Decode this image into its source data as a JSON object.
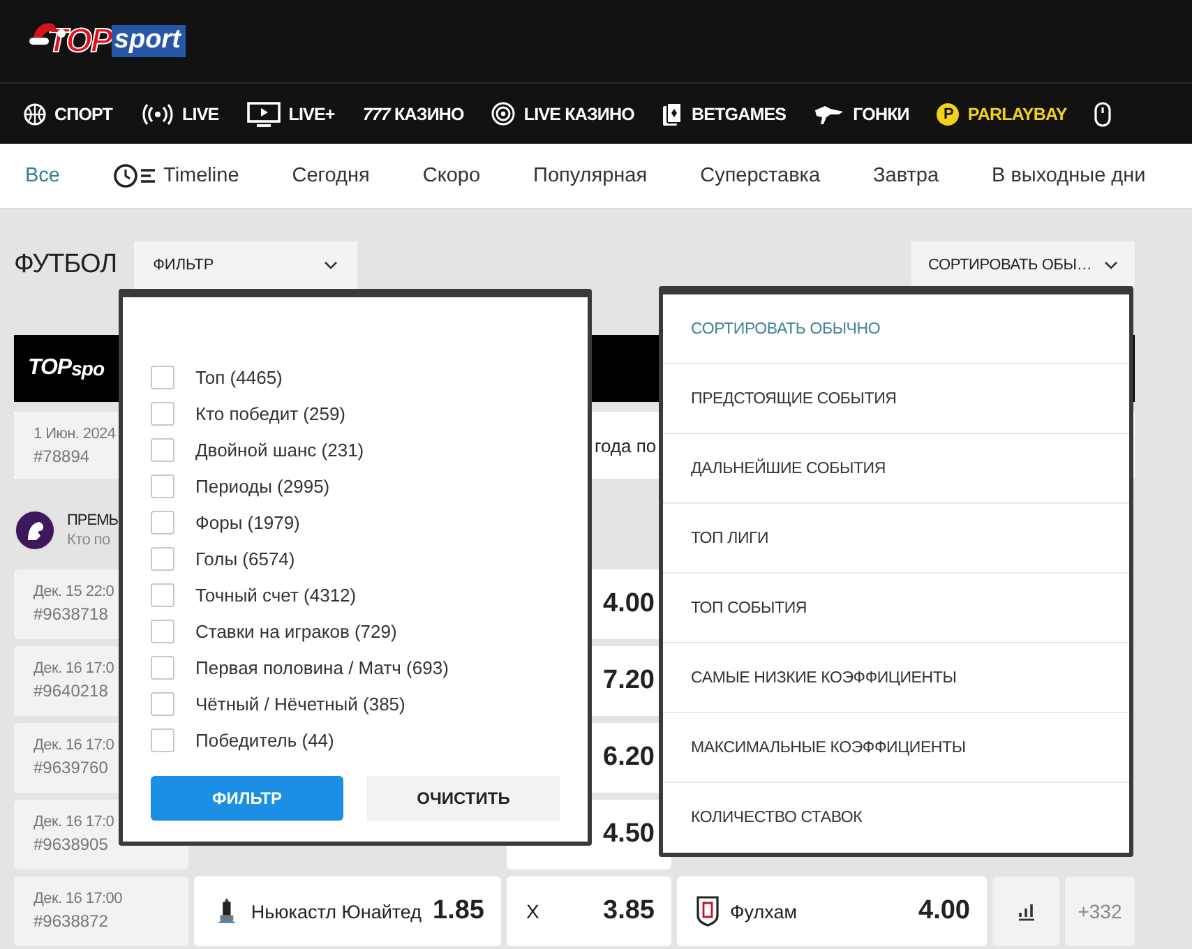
{
  "header": {
    "logo": {
      "part_1": "TOP",
      "part_2": "sport"
    }
  },
  "nav": [
    {
      "kind": "ball",
      "label": "СПОРТ",
      "highlighted": false
    },
    {
      "kind": "live",
      "label": "LIVE",
      "highlighted": false
    },
    {
      "kind": "tv",
      "label": "LIVE+",
      "highlighted": false
    },
    {
      "kind": "plain",
      "label": "*777* КАЗИНО",
      "highlighted": false
    },
    {
      "kind": "target",
      "label": "LIVE КАЗИНО",
      "highlighted": false
    },
    {
      "kind": "cards",
      "label": "BETGAMES",
      "highlighted": false
    },
    {
      "kind": "dog",
      "label": "ГОНКИ",
      "highlighted": false
    },
    {
      "kind": "coin",
      "icon_text": "P",
      "label": "PARLAYBAY",
      "highlighted": true
    },
    {
      "kind": "mouse"
    }
  ],
  "tabs": [
    {
      "label": "Все",
      "selected": true
    },
    {
      "label": "Timeline",
      "kind": "timeline",
      "selected": false
    },
    {
      "label": "Сегодня",
      "selected": false
    },
    {
      "label": "Скоро",
      "selected": false
    },
    {
      "label": "Популярная",
      "selected": false
    },
    {
      "label": "Суперставка",
      "selected": false
    },
    {
      "label": "Завтра",
      "selected": false
    },
    {
      "label": "В выходные дни",
      "selected": false
    }
  ],
  "toolbar": {
    "title": "ФУТБОЛ",
    "filter_button": "ФИЛЬТР",
    "sort_button": "СОРТИРОВАТЬ ОБЫ…"
  },
  "banner": {
    "part_1": "TOP",
    "part_2": "spo"
  },
  "promo": {
    "date": "1 Июн. 2024",
    "id": "#78894",
    "text": "года по"
  },
  "league": {
    "title": "ПРЕМЬ",
    "subtitle": "Кто по"
  },
  "matches": [
    {
      "date": "Дек. 15 22:0",
      "id": "#9638718",
      "draw_odds": "4.00"
    },
    {
      "date": "Дек. 16 17:0",
      "id": "#9640218",
      "draw_odds": "7.20"
    },
    {
      "date": "Дек. 16 17:0",
      "id": "#9639760",
      "draw_odds": "6.20"
    },
    {
      "date": "Дек. 16 17:0",
      "id": "#9638905",
      "draw_odds": "4.50"
    },
    {
      "date": "Дек. 16 17:00",
      "id": "#9638872",
      "home": "Ньюкастл Юнайтед",
      "home_odds": "1.85",
      "draw_label": "X",
      "draw_odds": "3.85",
      "away": "Фулхам",
      "away_odds": "4.00",
      "more": "+332"
    }
  ],
  "filter_menu": {
    "options": [
      {
        "label": "Топ (4465)",
        "checked": false
      },
      {
        "label": "Кто победит (259)",
        "checked": false
      },
      {
        "label": "Двойной шанс (231)",
        "checked": false
      },
      {
        "label": "Периоды (2995)",
        "checked": false
      },
      {
        "label": "Форы (1979)",
        "checked": false
      },
      {
        "label": "Голы (6574)",
        "checked": false
      },
      {
        "label": "Точный счет (4312)",
        "checked": false
      },
      {
        "label": "Ставки на играков (729)",
        "checked": false
      },
      {
        "label": "Первая половина / Матч (693)",
        "checked": false
      },
      {
        "label": "Чётный / Нёчетный (385)",
        "checked": false
      },
      {
        "label": "Победитель (44)",
        "checked": false
      }
    ],
    "buttons": [
      {
        "label": "ФИЛЬТР",
        "kind": "primary"
      },
      {
        "label": "ОЧИСТИТЬ",
        "kind": "secondary"
      }
    ]
  },
  "sort_menu": {
    "options": [
      {
        "label": "СОРТИРОВАТЬ ОБЫЧНО",
        "selected": true
      },
      {
        "label": "ПРЕДСТОЯЩИЕ СОБЫТИЯ",
        "selected": false
      },
      {
        "label": "ДАЛЬНЕЙШИЕ СОБЫТИЯ",
        "selected": false
      },
      {
        "label": "ТОП ЛИГИ",
        "selected": false
      },
      {
        "label": "ТОП СОБЫТИЯ",
        "selected": false
      },
      {
        "label": "САМЫЕ НИЗКИЕ КОЭФФИЦИЕНТЫ",
        "selected": false
      },
      {
        "label": "МАКСИМАЛЬНЫЕ КОЭФФИЦИЕНТЫ",
        "selected": false
      },
      {
        "label": "КОЛИЧЕСТВО СТАВОК",
        "selected": false
      }
    ]
  }
}
